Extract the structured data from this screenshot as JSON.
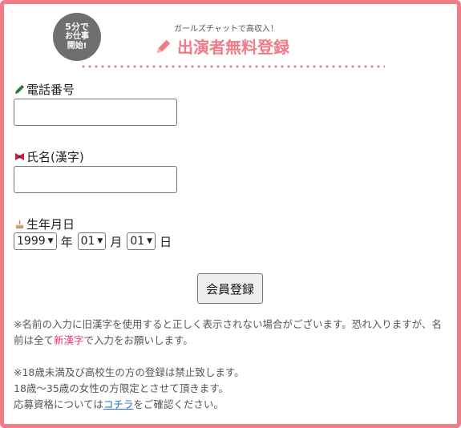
{
  "header": {
    "badge_lines": [
      "5分で",
      "お仕事",
      "開始!"
    ],
    "tagline": "ガールズチャットで高収入！",
    "title": "出演者無料登録"
  },
  "form": {
    "phone": {
      "label": "電話番号",
      "value": "",
      "icon": "pencil-icon"
    },
    "name": {
      "label": "氏名(漢字)",
      "value": "",
      "icon": "ribbon-icon"
    },
    "dob": {
      "label": "生年月日",
      "icon": "cake-icon",
      "year": "1999",
      "year_unit": "年",
      "month": "01",
      "month_unit": "月",
      "day": "01",
      "day_unit": "日"
    },
    "submit_label": "会員登録"
  },
  "notes": {
    "line1_a": "※名前の入力に旧漢字を使用すると正しく表示されない場合がございます。恐れ入りますが、名前は全て",
    "line1_hl": "新漢字",
    "line1_b": "で入力をお願いします。",
    "line2": "※18歳未満及び高校生の方の登録は禁止致します。",
    "line3": "18歳～35歳の女性の方限定とさせて頂きます。",
    "line4_a": "応募資格については",
    "line4_link": "コチラ",
    "line4_b": "をご確認ください。"
  },
  "colors": {
    "border": "#f07c89",
    "title": "#ef7b88",
    "badge": "#6f6f6f",
    "highlight": "#e8396b",
    "link": "#2a72c8"
  }
}
